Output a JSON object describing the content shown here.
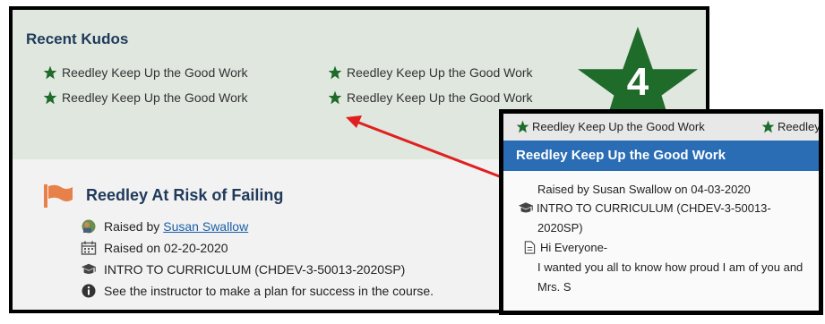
{
  "kudos": {
    "title": "Recent Kudos",
    "items": [
      {
        "label": "Reedley Keep Up the Good Work"
      },
      {
        "label": "Reedley Keep Up the Good Work"
      },
      {
        "label": "Reedley Keep Up the Good Work"
      },
      {
        "label": "Reedley Keep Up the Good Work"
      }
    ],
    "count": "4",
    "star_color": "#1e6b2a"
  },
  "alert": {
    "title": "Reedley At Risk of Failing",
    "raised_by_prefix": "Raised by",
    "raised_by_name": "Susan Swallow",
    "raised_on": "Raised on 02-20-2020",
    "course": "INTRO TO CURRICULUM (CHDEV-3-50013-2020SP)",
    "info": "See the instructor to make a plan for success in the course.",
    "flag_color": "#e8804a"
  },
  "popup": {
    "top_items": [
      "Reedley Keep Up the Good Work",
      "Reedley"
    ],
    "header": "Reedley Keep Up the Good Work",
    "header_color": "#2a6db5",
    "raised_line": "Raised by Susan Swallow on 04-03-2020",
    "course_line1": "INTRO TO CURRICULUM (CHDEV-3-50013-",
    "course_line2": "2020SP)",
    "message_line1": "Hi Everyone-",
    "message_line2": "I wanted you all to know how proud I am of you and",
    "message_line3": "Mrs. S"
  },
  "annotation": {
    "arrow_color": "#e02020"
  }
}
